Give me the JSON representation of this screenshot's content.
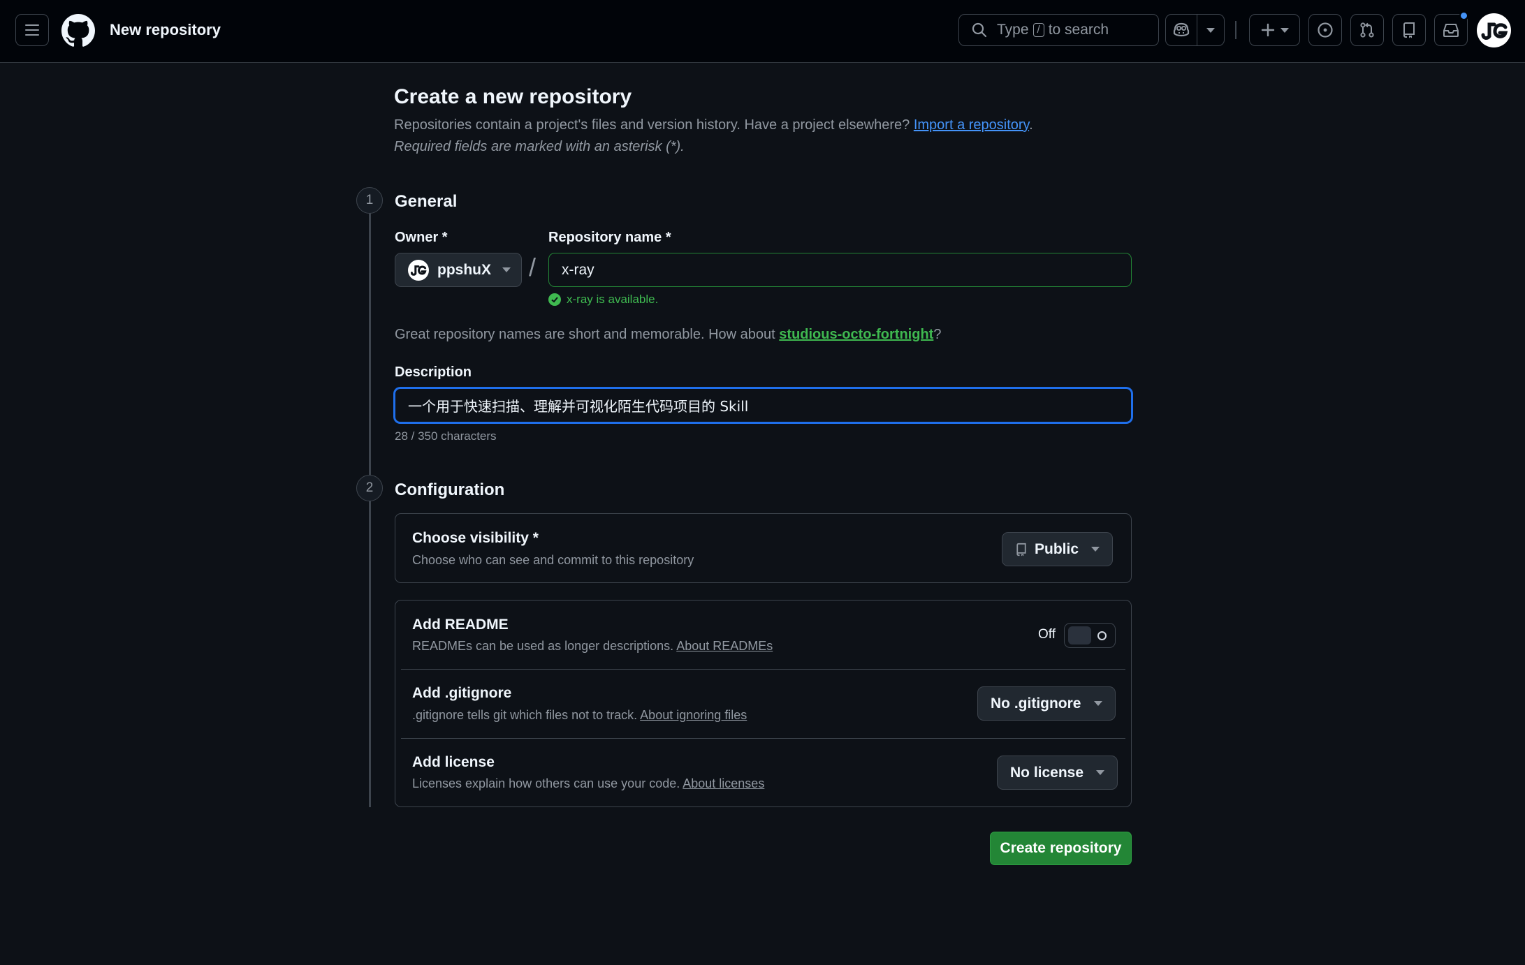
{
  "header": {
    "title": "New repository",
    "search": {
      "prefix": "Type",
      "key": "/",
      "suffix": "to search"
    },
    "icons": [
      "menu-icon",
      "github-logo-icon",
      "search-icon",
      "copilot-icon",
      "chevron-down-icon",
      "plus-icon",
      "issue-icon",
      "pull-request-icon",
      "repo-icon",
      "inbox-icon",
      "avatar"
    ]
  },
  "intro": {
    "title": "Create a new repository",
    "lead_text": "Repositories contain a project's files and version history. Have a project elsewhere?",
    "import_link": "Import a repository",
    "lead_end": ".",
    "required_note": "Required fields are marked with an asterisk (*)."
  },
  "general": {
    "step": "1",
    "heading": "General",
    "owner_label": "Owner *",
    "owner_value": "ppshuX",
    "separator": "/",
    "repo_name_label": "Repository name *",
    "repo_name_value": "x-ray",
    "availability": "x-ray is available.",
    "suggest_prefix": "Great repository names are short and memorable. How about",
    "suggest_name": "studious-octo-fortnight",
    "suggest_suffix": "?",
    "description_label": "Description",
    "description_value": "一个用于快速扫描、理解并可视化陌生代码项目的 Skill",
    "char_count": "28 / 350 characters"
  },
  "configuration": {
    "step": "2",
    "heading": "Configuration",
    "visibility": {
      "title": "Choose visibility *",
      "subtitle": "Choose who can see and commit to this repository",
      "value": "Public"
    },
    "readme": {
      "title": "Add README",
      "subtitle": "READMEs can be used as longer descriptions.",
      "link": "About READMEs",
      "toggle_state": "Off"
    },
    "gitignore": {
      "title": "Add .gitignore",
      "subtitle": ".gitignore tells git which files not to track.",
      "link": "About ignoring files",
      "value": "No .gitignore"
    },
    "license": {
      "title": "Add license",
      "subtitle": "Licenses explain how others can use your code.",
      "link": "About licenses",
      "value": "No license"
    }
  },
  "actions": {
    "create_label": "Create repository"
  },
  "colors": {
    "background": "#0d1117",
    "header_bg": "#010409",
    "primary_button": "#238636",
    "success_text": "#3fb950",
    "link": "#4493f8",
    "focus_border": "#1f6feb"
  }
}
